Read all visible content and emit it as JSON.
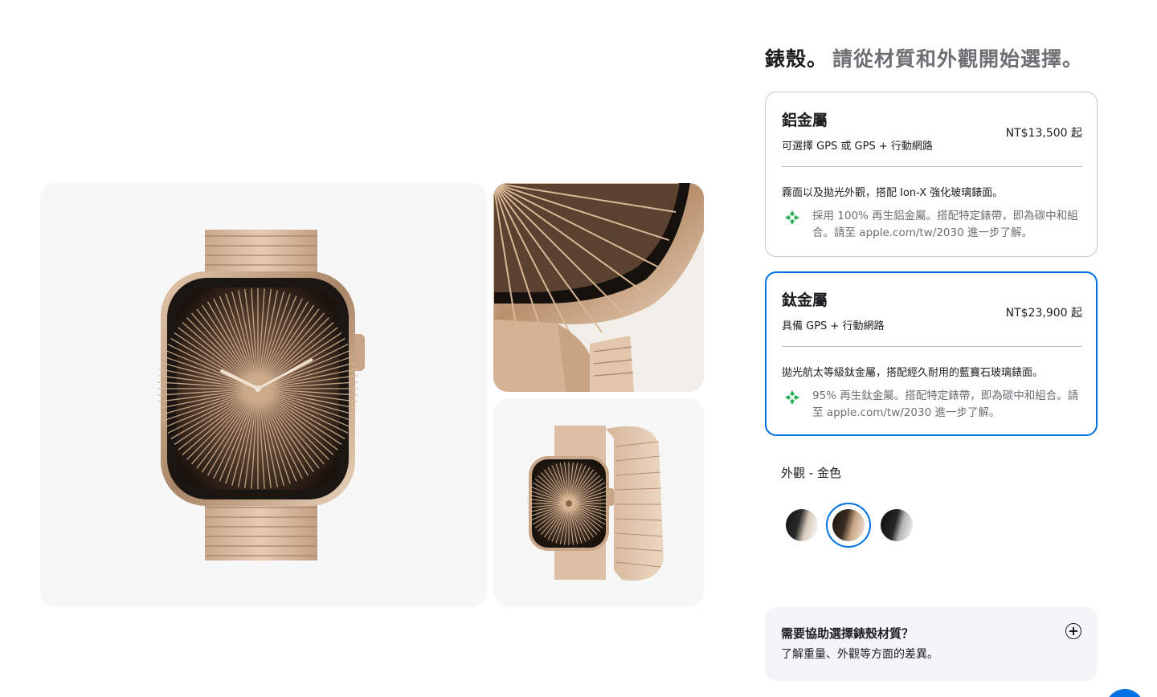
{
  "gallery": {
    "images": [
      {
        "name": "watch-front-view",
        "alt": "Apple Watch 鈦金屬 金色 正面"
      },
      {
        "name": "watch-closeup-view",
        "alt": "錶殼特寫"
      },
      {
        "name": "watch-side-view",
        "alt": "側面視圖"
      }
    ]
  },
  "case": {
    "heading_strong": "錶殼。",
    "heading_sub": "請從材質和外觀開始選擇。"
  },
  "options": [
    {
      "name": "鋁金屬",
      "connectivity": "可選擇 GPS 或 GPS + 行動網路",
      "price": "NT$13,500 起",
      "description": "霧面以及拋光外觀，搭配 Ion-X 強化玻璃錶面。",
      "eco": "採用 100% 再生鋁金屬。搭配特定錶帶，即為碳中和組合。請至 apple.com/tw/2030 進一步了解。",
      "selected": false
    },
    {
      "name": "鈦金屬",
      "connectivity": "具備 GPS + 行動網路",
      "price": "NT$23,900 起",
      "description": "拋光航太等級鈦金屬，搭配經久耐用的藍寶石玻璃錶面。",
      "eco": "95% 再生鈦金屬。搭配特定錶帶，即為碳中和組合。請至 apple.com/tw/2030 進一步了解。",
      "selected": true
    }
  ],
  "finish": {
    "label": "外觀 - 金色",
    "swatches": [
      {
        "name": "slate",
        "selected": false
      },
      {
        "name": "gold",
        "selected": true
      },
      {
        "name": "natural",
        "selected": false
      }
    ]
  },
  "help": {
    "title": "需要協助選擇錶殼材質？",
    "subtitle": "了解重量、外觀等方面的差異。"
  },
  "colors": {
    "accent": "#0071e3",
    "eco_green": "#30b45a",
    "text_primary": "#1d1d1f",
    "text_secondary": "#6e6e73"
  }
}
